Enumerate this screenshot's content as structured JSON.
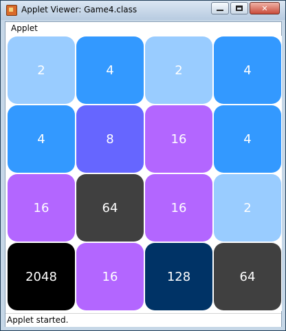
{
  "window": {
    "title": "Applet Viewer: Game4.class",
    "controls": {
      "minimize": "minimize",
      "maximize": "maximize",
      "close": "✕"
    }
  },
  "menu": {
    "applet_label": "Applet"
  },
  "board": {
    "grid": [
      [
        {
          "value": "2",
          "color": "#99ccff"
        },
        {
          "value": "4",
          "color": "#3399ff"
        },
        {
          "value": "2",
          "color": "#99ccff"
        },
        {
          "value": "4",
          "color": "#3399ff"
        }
      ],
      [
        {
          "value": "4",
          "color": "#3399ff"
        },
        {
          "value": "8",
          "color": "#6666ff"
        },
        {
          "value": "16",
          "color": "#b366ff"
        },
        {
          "value": "4",
          "color": "#3399ff"
        }
      ],
      [
        {
          "value": "16",
          "color": "#b366ff"
        },
        {
          "value": "64",
          "color": "#404040"
        },
        {
          "value": "16",
          "color": "#b366ff"
        },
        {
          "value": "2",
          "color": "#99ccff"
        }
      ],
      [
        {
          "value": "2048",
          "color": "#000000"
        },
        {
          "value": "16",
          "color": "#b366ff"
        },
        {
          "value": "128",
          "color": "#003366"
        },
        {
          "value": "64",
          "color": "#404040"
        }
      ]
    ]
  },
  "status": {
    "text": "Applet started."
  }
}
